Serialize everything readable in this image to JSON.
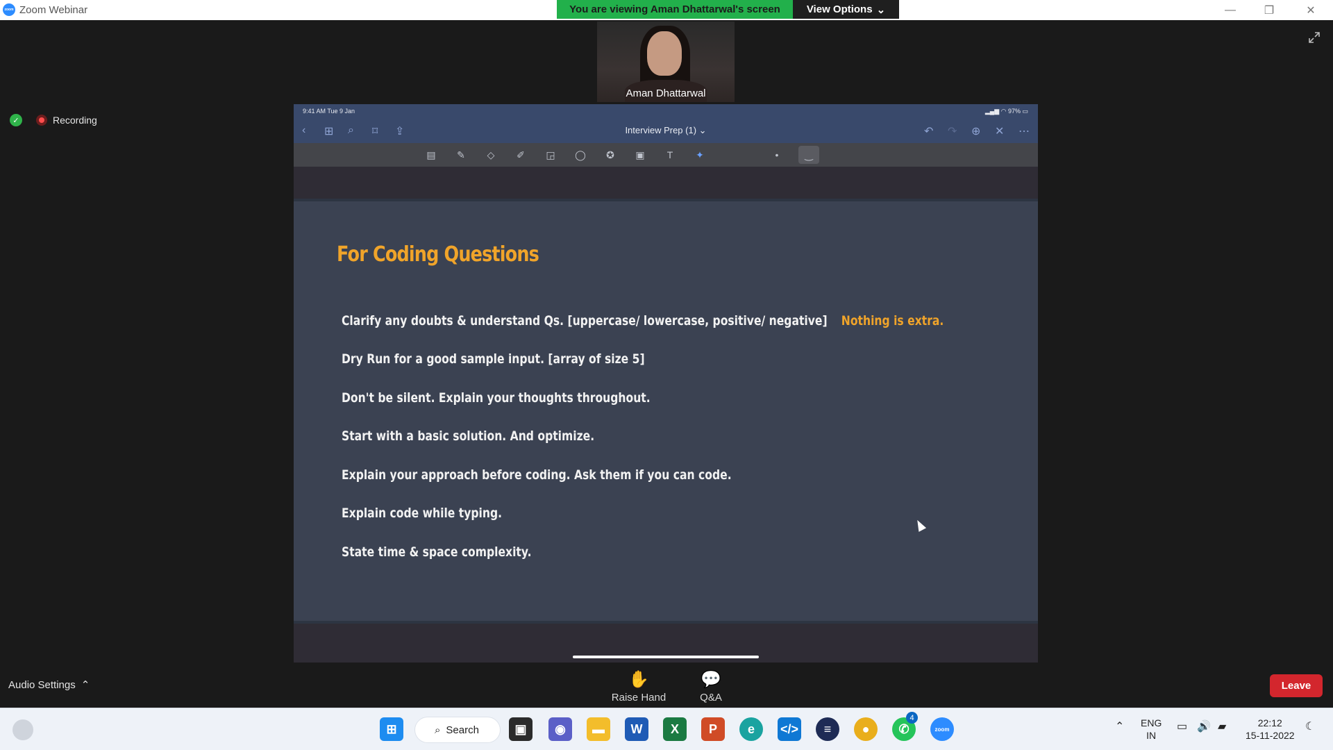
{
  "window": {
    "title": "Zoom Webinar",
    "logo_text": "zoom",
    "minimize": "—",
    "restore": "❐",
    "close": "✕"
  },
  "banner": {
    "viewing": "You are viewing Aman Dhattarwal's screen",
    "view_options": "View Options",
    "chevron": "⌄"
  },
  "status": {
    "recording": "Recording",
    "shield_icon": "✓"
  },
  "speaker": {
    "name": "Aman Dhattarwal"
  },
  "ipad": {
    "time": "9:41 AM  Tue 9 Jan",
    "battery": "97%",
    "doc_title": "Interview Prep (1)",
    "doc_chevron": "⌄"
  },
  "slide": {
    "title": "For Coding Questions",
    "bullets": [
      "Clarify any doubts & understand Qs. [uppercase/ lowercase, positive/ negative]",
      "Dry Run for a good sample input. [array of size 5]",
      "Don't be silent. Explain your thoughts throughout.",
      "Start with a basic solution. And optimize.",
      "Explain your approach before coding. Ask them if you can code.",
      "Explain code while typing.",
      "State time & space complexity."
    ],
    "highlight": "Nothing is extra."
  },
  "controls": {
    "audio_settings": "Audio Settings",
    "audio_chevron": "⌃",
    "raise_hand": "Raise Hand",
    "qa": "Q&A",
    "leave": "Leave"
  },
  "taskbar": {
    "search": "Search",
    "lang_top": "ENG",
    "lang_bottom": "IN",
    "time": "22:12",
    "date": "15-11-2022",
    "whatsapp_badge": "4"
  },
  "colors": {
    "accent_orange": "#f0a42a",
    "banner_green": "#22b04b",
    "leave_red": "#d3262d"
  }
}
